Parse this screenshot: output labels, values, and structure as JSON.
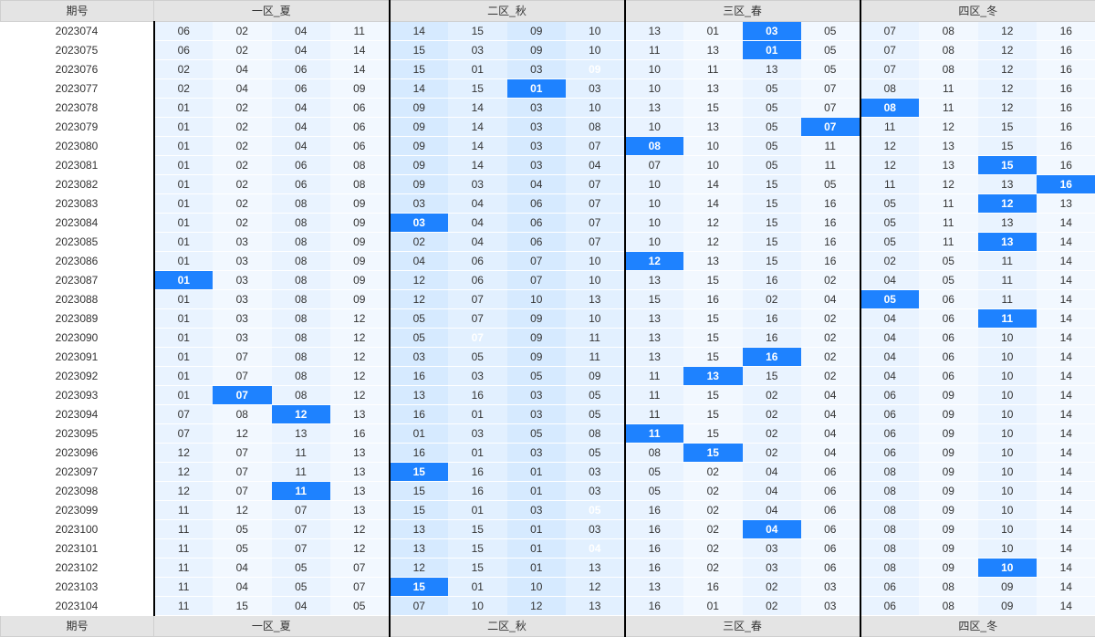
{
  "headers": {
    "period": "期号",
    "zones": [
      "一区_夏",
      "二区_秋",
      "三区_春",
      "四区_冬"
    ]
  },
  "rows": [
    {
      "p": "2023074",
      "c": [
        [
          "06",
          "02",
          "04",
          "11"
        ],
        [
          "14",
          "15",
          "09",
          "10"
        ],
        [
          "13",
          "01",
          "03",
          "05"
        ],
        [
          "07",
          "08",
          "12",
          "16"
        ]
      ],
      "hl": [
        [
          2,
          2
        ]
      ]
    },
    {
      "p": "2023075",
      "c": [
        [
          "06",
          "02",
          "04",
          "14"
        ],
        [
          "15",
          "03",
          "09",
          "10"
        ],
        [
          "11",
          "13",
          "01",
          "05"
        ],
        [
          "07",
          "08",
          "12",
          "16"
        ]
      ],
      "hl": [
        [
          2,
          2
        ]
      ]
    },
    {
      "p": "2023076",
      "c": [
        [
          "02",
          "04",
          "06",
          "14"
        ],
        [
          "15",
          "01",
          "03",
          "09"
        ],
        [
          "10",
          "11",
          "13",
          "05"
        ],
        [
          "07",
          "08",
          "12",
          "16"
        ]
      ],
      "hl": [
        [
          1,
          3
        ]
      ]
    },
    {
      "p": "2023077",
      "c": [
        [
          "02",
          "04",
          "06",
          "09"
        ],
        [
          "14",
          "15",
          "01",
          "03"
        ],
        [
          "10",
          "13",
          "05",
          "07"
        ],
        [
          "08",
          "11",
          "12",
          "16"
        ]
      ],
      "hl": [
        [
          1,
          2
        ]
      ]
    },
    {
      "p": "2023078",
      "c": [
        [
          "01",
          "02",
          "04",
          "06"
        ],
        [
          "09",
          "14",
          "03",
          "10"
        ],
        [
          "13",
          "15",
          "05",
          "07"
        ],
        [
          "08",
          "11",
          "12",
          "16"
        ]
      ],
      "hl": [
        [
          3,
          0
        ]
      ]
    },
    {
      "p": "2023079",
      "c": [
        [
          "01",
          "02",
          "04",
          "06"
        ],
        [
          "09",
          "14",
          "03",
          "08"
        ],
        [
          "10",
          "13",
          "05",
          "07"
        ],
        [
          "11",
          "12",
          "15",
          "16"
        ]
      ],
      "hl": [
        [
          2,
          3
        ]
      ]
    },
    {
      "p": "2023080",
      "c": [
        [
          "01",
          "02",
          "04",
          "06"
        ],
        [
          "09",
          "14",
          "03",
          "07"
        ],
        [
          "08",
          "10",
          "05",
          "11"
        ],
        [
          "12",
          "13",
          "15",
          "16"
        ]
      ],
      "hl": [
        [
          2,
          0
        ]
      ]
    },
    {
      "p": "2023081",
      "c": [
        [
          "01",
          "02",
          "06",
          "08"
        ],
        [
          "09",
          "14",
          "03",
          "04"
        ],
        [
          "07",
          "10",
          "05",
          "11"
        ],
        [
          "12",
          "13",
          "15",
          "16"
        ]
      ],
      "hl": [
        [
          3,
          2
        ]
      ]
    },
    {
      "p": "2023082",
      "c": [
        [
          "01",
          "02",
          "06",
          "08"
        ],
        [
          "09",
          "03",
          "04",
          "07"
        ],
        [
          "10",
          "14",
          "15",
          "05"
        ],
        [
          "11",
          "12",
          "13",
          "16"
        ]
      ],
      "hl": [
        [
          3,
          3
        ]
      ]
    },
    {
      "p": "2023083",
      "c": [
        [
          "01",
          "02",
          "08",
          "09"
        ],
        [
          "03",
          "04",
          "06",
          "07"
        ],
        [
          "10",
          "14",
          "15",
          "16"
        ],
        [
          "05",
          "11",
          "12",
          "13"
        ]
      ],
      "hl": [
        [
          3,
          2
        ]
      ]
    },
    {
      "p": "2023084",
      "c": [
        [
          "01",
          "02",
          "08",
          "09"
        ],
        [
          "03",
          "04",
          "06",
          "07"
        ],
        [
          "10",
          "12",
          "15",
          "16"
        ],
        [
          "05",
          "11",
          "13",
          "14"
        ]
      ],
      "hl": [
        [
          1,
          0
        ]
      ]
    },
    {
      "p": "2023085",
      "c": [
        [
          "01",
          "03",
          "08",
          "09"
        ],
        [
          "02",
          "04",
          "06",
          "07"
        ],
        [
          "10",
          "12",
          "15",
          "16"
        ],
        [
          "05",
          "11",
          "13",
          "14"
        ]
      ],
      "hl": [
        [
          3,
          2
        ]
      ]
    },
    {
      "p": "2023086",
      "c": [
        [
          "01",
          "03",
          "08",
          "09"
        ],
        [
          "04",
          "06",
          "07",
          "10"
        ],
        [
          "12",
          "13",
          "15",
          "16"
        ],
        [
          "02",
          "05",
          "11",
          "14"
        ]
      ],
      "hl": [
        [
          2,
          0
        ]
      ]
    },
    {
      "p": "2023087",
      "c": [
        [
          "01",
          "03",
          "08",
          "09"
        ],
        [
          "12",
          "06",
          "07",
          "10"
        ],
        [
          "13",
          "15",
          "16",
          "02"
        ],
        [
          "04",
          "05",
          "11",
          "14"
        ]
      ],
      "hl": [
        [
          0,
          0
        ]
      ]
    },
    {
      "p": "2023088",
      "c": [
        [
          "01",
          "03",
          "08",
          "09"
        ],
        [
          "12",
          "07",
          "10",
          "13"
        ],
        [
          "15",
          "16",
          "02",
          "04"
        ],
        [
          "05",
          "06",
          "11",
          "14"
        ]
      ],
      "hl": [
        [
          3,
          0
        ]
      ]
    },
    {
      "p": "2023089",
      "c": [
        [
          "01",
          "03",
          "08",
          "12"
        ],
        [
          "05",
          "07",
          "09",
          "10"
        ],
        [
          "13",
          "15",
          "16",
          "02"
        ],
        [
          "04",
          "06",
          "11",
          "14"
        ]
      ],
      "hl": [
        [
          3,
          2
        ]
      ]
    },
    {
      "p": "2023090",
      "c": [
        [
          "01",
          "03",
          "08",
          "12"
        ],
        [
          "05",
          "07",
          "09",
          "11"
        ],
        [
          "13",
          "15",
          "16",
          "02"
        ],
        [
          "04",
          "06",
          "10",
          "14"
        ]
      ],
      "hl": [
        [
          1,
          1
        ]
      ]
    },
    {
      "p": "2023091",
      "c": [
        [
          "01",
          "07",
          "08",
          "12"
        ],
        [
          "03",
          "05",
          "09",
          "11"
        ],
        [
          "13",
          "15",
          "16",
          "02"
        ],
        [
          "04",
          "06",
          "10",
          "14"
        ]
      ],
      "hl": [
        [
          2,
          2
        ]
      ]
    },
    {
      "p": "2023092",
      "c": [
        [
          "01",
          "07",
          "08",
          "12"
        ],
        [
          "16",
          "03",
          "05",
          "09"
        ],
        [
          "11",
          "13",
          "15",
          "02"
        ],
        [
          "04",
          "06",
          "10",
          "14"
        ]
      ],
      "hl": [
        [
          2,
          1
        ]
      ]
    },
    {
      "p": "2023093",
      "c": [
        [
          "01",
          "07",
          "08",
          "12"
        ],
        [
          "13",
          "16",
          "03",
          "05"
        ],
        [
          "11",
          "15",
          "02",
          "04"
        ],
        [
          "06",
          "09",
          "10",
          "14"
        ]
      ],
      "hl": [
        [
          0,
          1
        ]
      ]
    },
    {
      "p": "2023094",
      "c": [
        [
          "07",
          "08",
          "12",
          "13"
        ],
        [
          "16",
          "01",
          "03",
          "05"
        ],
        [
          "11",
          "15",
          "02",
          "04"
        ],
        [
          "06",
          "09",
          "10",
          "14"
        ]
      ],
      "hl": [
        [
          0,
          2
        ]
      ]
    },
    {
      "p": "2023095",
      "c": [
        [
          "07",
          "12",
          "13",
          "16"
        ],
        [
          "01",
          "03",
          "05",
          "08"
        ],
        [
          "11",
          "15",
          "02",
          "04"
        ],
        [
          "06",
          "09",
          "10",
          "14"
        ]
      ],
      "hl": [
        [
          2,
          0
        ]
      ]
    },
    {
      "p": "2023096",
      "c": [
        [
          "12",
          "07",
          "11",
          "13"
        ],
        [
          "16",
          "01",
          "03",
          "05"
        ],
        [
          "08",
          "15",
          "02",
          "04"
        ],
        [
          "06",
          "09",
          "10",
          "14"
        ]
      ],
      "hl": [
        [
          2,
          1
        ]
      ]
    },
    {
      "p": "2023097",
      "c": [
        [
          "12",
          "07",
          "11",
          "13"
        ],
        [
          "15",
          "16",
          "01",
          "03"
        ],
        [
          "05",
          "02",
          "04",
          "06"
        ],
        [
          "08",
          "09",
          "10",
          "14"
        ]
      ],
      "hl": [
        [
          1,
          0
        ]
      ]
    },
    {
      "p": "2023098",
      "c": [
        [
          "12",
          "07",
          "11",
          "13"
        ],
        [
          "15",
          "16",
          "01",
          "03"
        ],
        [
          "05",
          "02",
          "04",
          "06"
        ],
        [
          "08",
          "09",
          "10",
          "14"
        ]
      ],
      "hl": [
        [
          0,
          2
        ]
      ]
    },
    {
      "p": "2023099",
      "c": [
        [
          "11",
          "12",
          "07",
          "13"
        ],
        [
          "15",
          "01",
          "03",
          "05"
        ],
        [
          "16",
          "02",
          "04",
          "06"
        ],
        [
          "08",
          "09",
          "10",
          "14"
        ]
      ],
      "hl": [
        [
          1,
          3
        ]
      ]
    },
    {
      "p": "2023100",
      "c": [
        [
          "11",
          "05",
          "07",
          "12"
        ],
        [
          "13",
          "15",
          "01",
          "03"
        ],
        [
          "16",
          "02",
          "04",
          "06"
        ],
        [
          "08",
          "09",
          "10",
          "14"
        ]
      ],
      "hl": [
        [
          2,
          2
        ]
      ]
    },
    {
      "p": "2023101",
      "c": [
        [
          "11",
          "05",
          "07",
          "12"
        ],
        [
          "13",
          "15",
          "01",
          "04"
        ],
        [
          "16",
          "02",
          "03",
          "06"
        ],
        [
          "08",
          "09",
          "10",
          "14"
        ]
      ],
      "hl": [
        [
          1,
          3
        ]
      ]
    },
    {
      "p": "2023102",
      "c": [
        [
          "11",
          "04",
          "05",
          "07"
        ],
        [
          "12",
          "15",
          "01",
          "13"
        ],
        [
          "16",
          "02",
          "03",
          "06"
        ],
        [
          "08",
          "09",
          "10",
          "14"
        ]
      ],
      "hl": [
        [
          3,
          2
        ]
      ]
    },
    {
      "p": "2023103",
      "c": [
        [
          "11",
          "04",
          "05",
          "07"
        ],
        [
          "15",
          "01",
          "10",
          "12"
        ],
        [
          "13",
          "16",
          "02",
          "03"
        ],
        [
          "06",
          "08",
          "09",
          "14"
        ]
      ],
      "hl": [
        [
          1,
          0
        ]
      ]
    },
    {
      "p": "2023104",
      "c": [
        [
          "11",
          "15",
          "04",
          "05"
        ],
        [
          "07",
          "10",
          "12",
          "13"
        ],
        [
          "16",
          "01",
          "02",
          "03"
        ],
        [
          "06",
          "08",
          "09",
          "14"
        ]
      ],
      "hl": []
    }
  ]
}
